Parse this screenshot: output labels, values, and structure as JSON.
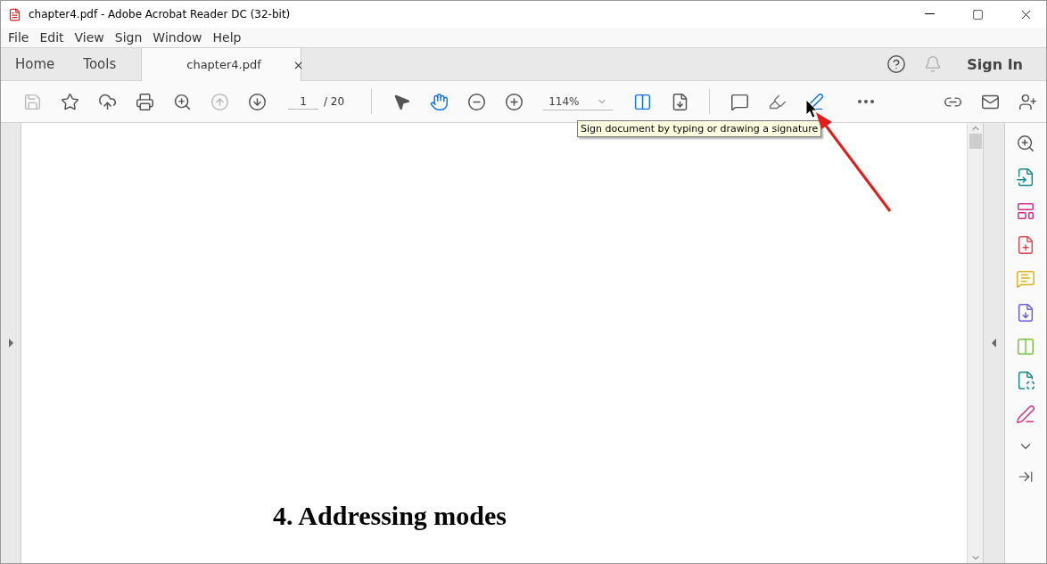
{
  "window": {
    "title": "chapter4.pdf - Adobe Acrobat Reader DC (32-bit)"
  },
  "menu": [
    "File",
    "Edit",
    "View",
    "Sign",
    "Window",
    "Help"
  ],
  "tabs": [
    {
      "label": "Home",
      "kind": "nav",
      "selected": false
    },
    {
      "label": "Tools",
      "kind": "nav",
      "selected": false
    },
    {
      "label": "chapter4.pdf",
      "kind": "document",
      "close": "×",
      "selected": true
    }
  ],
  "sign_in": "Sign In",
  "toolbar": {
    "page": "1",
    "page_total": "/ 20",
    "zoom": "114%",
    "tooltip": "Sign document by typing or drawing a signature"
  },
  "document": {
    "heading": "4. Addressing modes"
  }
}
